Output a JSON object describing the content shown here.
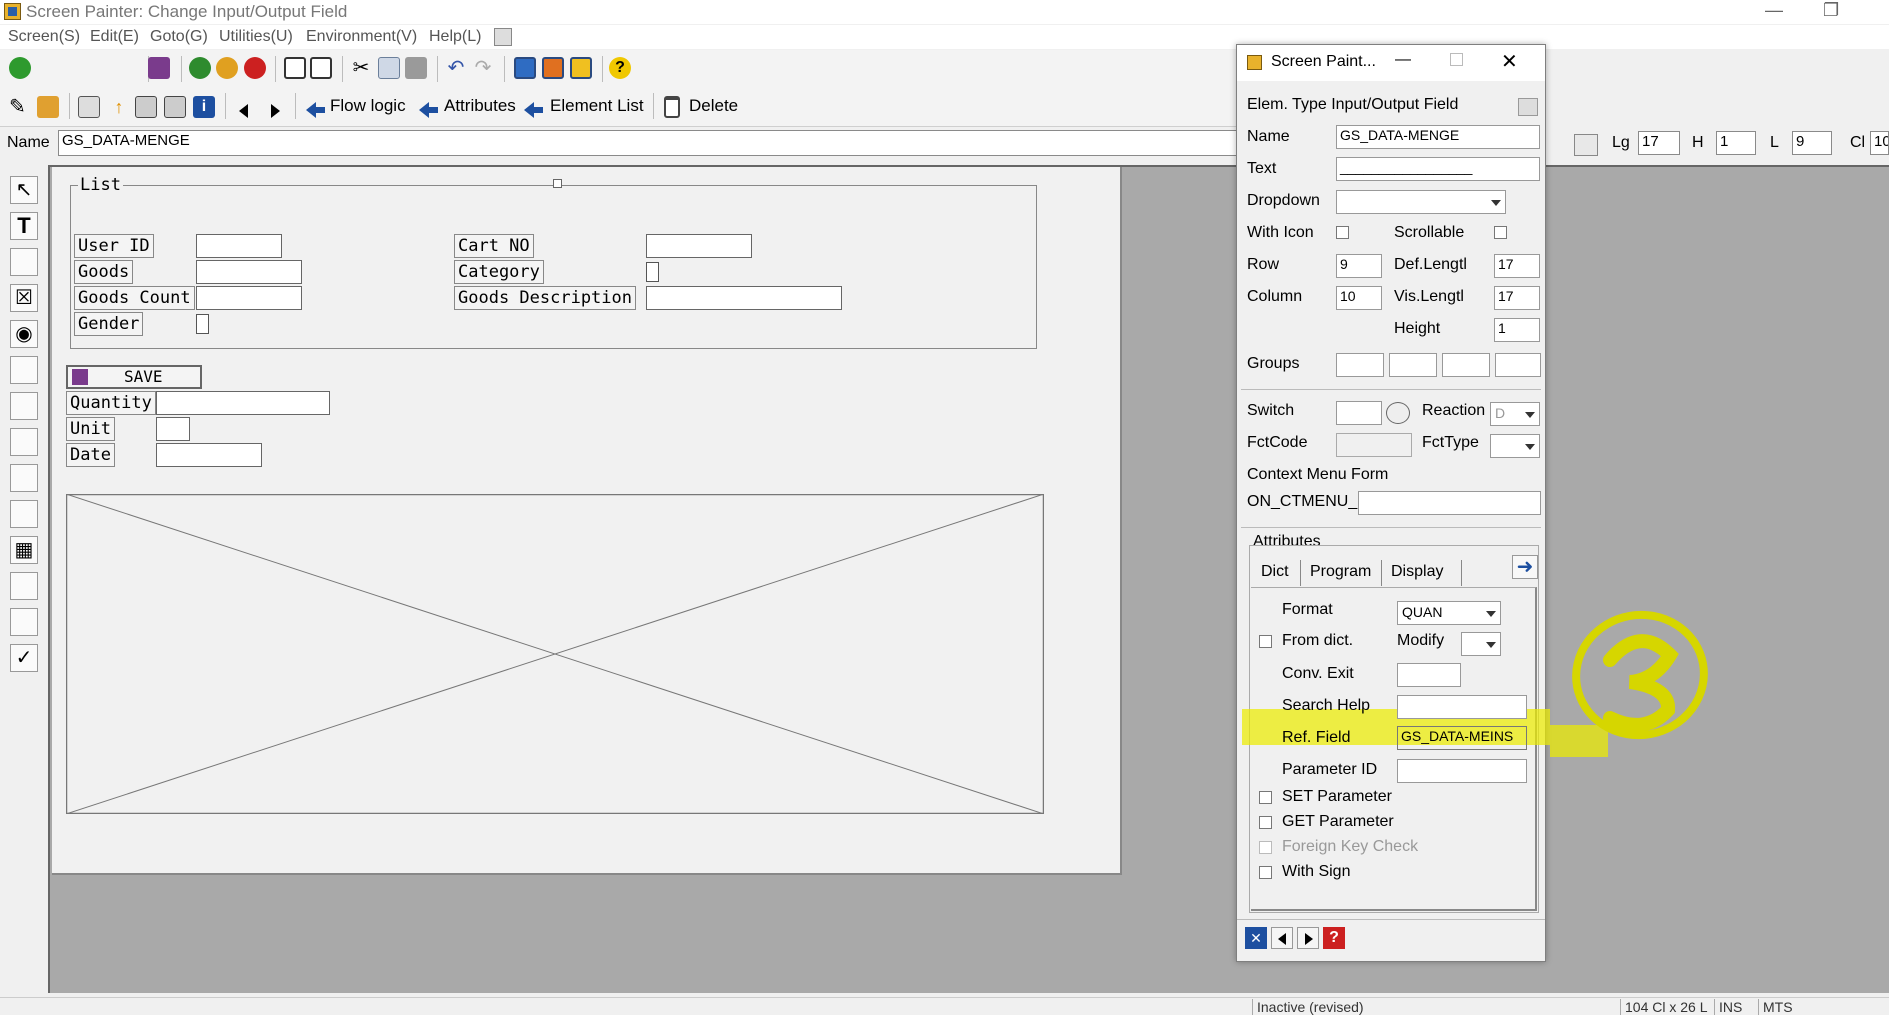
{
  "window": {
    "title": "Screen Painter:  Change Input/Output Field"
  },
  "menu": [
    "Screen(S)",
    "Edit(E)",
    "Goto(G)",
    "Utilities(U)",
    "Environment(V)",
    "Help(L)"
  ],
  "toolbar2": {
    "flow_logic": "Flow logic",
    "attributes": "Attributes",
    "element_list": "Element List",
    "delete": "Delete"
  },
  "name_row": {
    "label": "Name",
    "value": "GS_DATA-MENGE",
    "lg_label": "Lg",
    "lg_value": "17",
    "h_label": "H",
    "h_value": "1",
    "l_label": "L",
    "l_value": "9",
    "cl_label": "Cl",
    "cl_value": "10"
  },
  "canvas": {
    "frame_title": "List",
    "labels": {
      "user_id": "User ID",
      "goods": "Goods",
      "goods_count": "Goods Count",
      "gender": "Gender",
      "cart_no": "Cart NO",
      "category": "Category",
      "goods_description": "Goods Description",
      "save": "SAVE",
      "quantity": "Quantity",
      "unit": "Unit",
      "date": "Date"
    }
  },
  "popup": {
    "title": "Screen Paint...",
    "elem_type": "Elem. Type Input/Output Field",
    "name_label": "Name",
    "name_value": "GS_DATA-MENGE",
    "text_label": "Text",
    "text_value": "_________________",
    "dropdown_label": "Dropdown",
    "with_icon_label": "With Icon",
    "scrollable_label": "Scrollable",
    "row_label": "Row",
    "row_value": "9",
    "deflength_label": "Def.Lengtl",
    "deflength_value": "17",
    "column_label": "Column",
    "column_value": "10",
    "vislength_label": "Vis.Lengtl",
    "vislength_value": "17",
    "height_label": "Height",
    "height_value": "1",
    "groups_label": "Groups",
    "switch_label": "Switch",
    "reaction_label": "Reaction",
    "reaction_value": "D",
    "fctcode_label": "FctCode",
    "fcttype_label": "FctType",
    "context_menu_label": "Context Menu Form",
    "on_ctmenu_label": "ON_CTMENU_",
    "attributes_label": "Attributes",
    "tabs": [
      "Dict",
      "Program",
      "Display"
    ],
    "format_label": "Format",
    "format_value": "QUAN",
    "from_dict_label": "From dict.",
    "modify_label": "Modify",
    "conv_exit_label": "Conv. Exit",
    "search_help_label": "Search Help",
    "ref_field_label": "Ref. Field",
    "ref_field_value": "GS_DATA-MEINS",
    "parameter_id_label": "Parameter ID",
    "set_parameter_label": "SET Parameter",
    "get_parameter_label": "GET Parameter",
    "foreign_key_label": "Foreign Key Check",
    "with_sign_label": "With Sign"
  },
  "status": {
    "state": "Inactive (revised)",
    "pos": "104 Cl x 26 L",
    "mode": "INS",
    "system": "MTS"
  },
  "colors": {
    "highlight": "#ebeb00",
    "arrow_blue": "#1d4fa0"
  }
}
